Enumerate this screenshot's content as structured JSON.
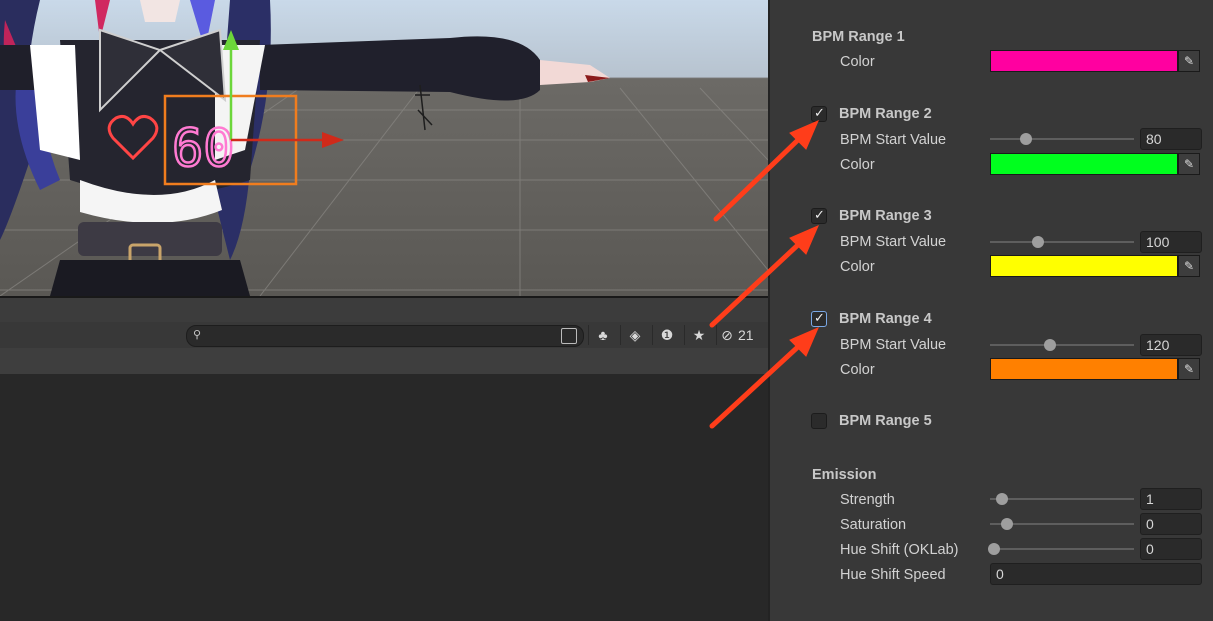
{
  "toolbar": {
    "hidden_count": "21",
    "search": {
      "placeholder": ""
    }
  },
  "inspector": {
    "ranges": [
      {
        "label": "BPM Range 1",
        "checkbox": null,
        "start_label": null,
        "start_value": null,
        "slider": null,
        "color_label": "Color",
        "color": "#ff00a0"
      },
      {
        "label": "BPM Range 2",
        "checkbox": true,
        "start_label": "BPM Start Value",
        "start_value": "80",
        "slider": 0.25,
        "color_label": "Color",
        "color": "#00ff1e"
      },
      {
        "label": "BPM Range 3",
        "checkbox": true,
        "start_label": "BPM Start Value",
        "start_value": "100",
        "slider": 0.33,
        "color_label": "Color",
        "color": "#ffff00"
      },
      {
        "label": "BPM Range 4",
        "checkbox": true,
        "start_label": "BPM Start Value",
        "start_value": "120",
        "slider": 0.42,
        "color_label": "Color",
        "color": "#ff8000"
      },
      {
        "label": "BPM Range 5",
        "checkbox": false
      }
    ],
    "emission": {
      "title": "Emission",
      "strength": {
        "label": "Strength",
        "value": "1",
        "slider": 0.08
      },
      "saturation": {
        "label": "Saturation",
        "value": "0",
        "slider": 0.12
      },
      "hue_shift": {
        "label": "Hue Shift (OKLab)",
        "value": "0",
        "slider": 0.03
      },
      "hue_shift_speed": {
        "label": "Hue Shift Speed",
        "value": "0"
      }
    }
  },
  "scene": {
    "neon_number": "60",
    "heart_glyph": "♡"
  },
  "colors": {
    "arrow": "#ff3d1a",
    "selection": "#f07d1e",
    "neon": "#ff4fc7"
  }
}
